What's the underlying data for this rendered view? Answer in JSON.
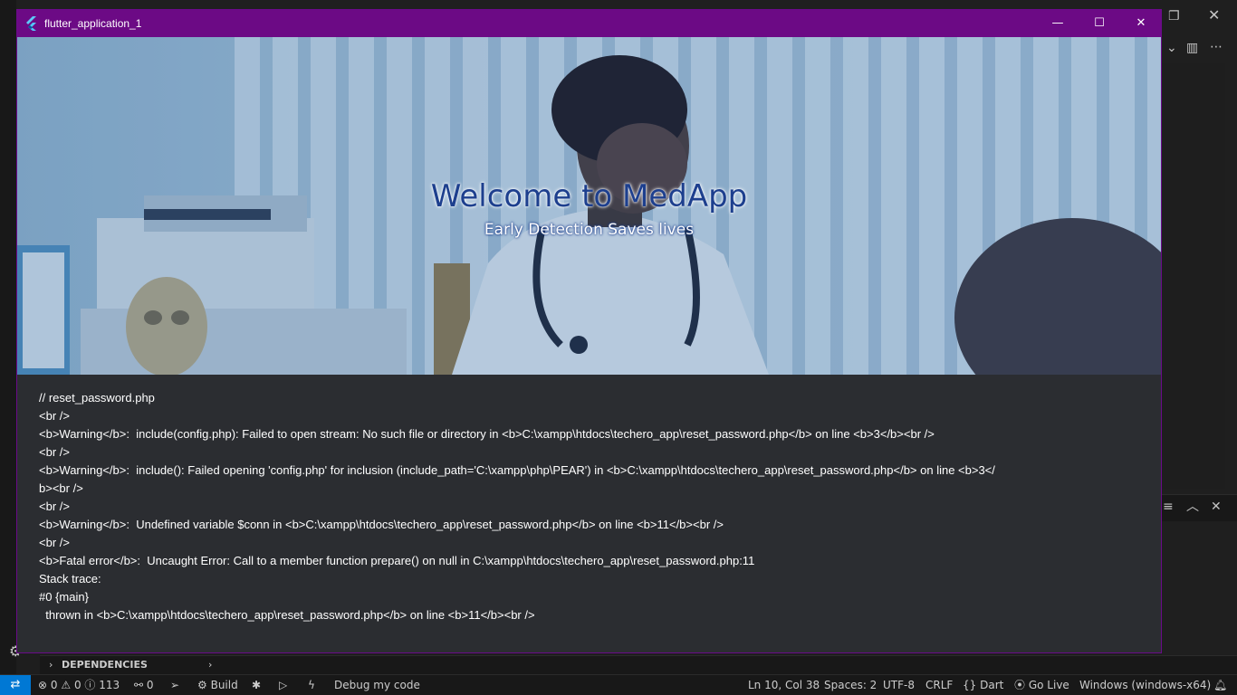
{
  "window": {
    "title": "flutter_application_1",
    "controls": {
      "minimize_icon": "minimize-icon",
      "maximize_icon": "maximize-icon",
      "close_icon": "close-icon"
    }
  },
  "hero": {
    "title": "Welcome to MedApp",
    "subtitle": "Early Detection Saves lives"
  },
  "error_log": [
    "// reset_password.php",
    "<br />",
    "<b>Warning</b>:  include(config.php): Failed to open stream: No such file or directory in <b>C:\\xampp\\htdocs\\techero_app\\reset_password.php</b> on line <b>3</b><br />",
    "<br />",
    "<b>Warning</b>:  include(): Failed opening 'config.php' for inclusion (include_path='C:\\xampp\\php\\PEAR') in <b>C:\\xampp\\htdocs\\techero_app\\reset_password.php</b> on line <b>3</",
    "b><br />",
    "<br />",
    "<b>Warning</b>:  Undefined variable $conn in <b>C:\\xampp\\htdocs\\techero_app\\reset_password.php</b> on line <b>11</b><br />",
    "<br />",
    "<b>Fatal error</b>:  Uncaught Error: Call to a member function prepare() on null in C:\\xampp\\htdocs\\techero_app\\reset_password.php:11",
    "Stack trace:",
    "#0 {main}",
    "  thrown in <b>C:\\xampp\\htdocs\\techero_app\\reset_password.php</b> on line <b>11</b><br />"
  ],
  "sidebar_section": {
    "label": "DEPENDENCIES"
  },
  "statusbar": {
    "errors": "0",
    "warnings": "0",
    "info": "113",
    "ports": "0",
    "build": "Build",
    "debug": "Debug my code",
    "cursor": "Ln 10, Col 38",
    "spaces": "Spaces: 2",
    "encoding": "UTF-8",
    "eol": "CRLF",
    "language": "Dart",
    "golive": "Go Live",
    "device": "Windows (windows-x64)"
  },
  "colors": {
    "titlebar": "#6c0a85",
    "hero_title": "#1d3f8e",
    "log_bg": "#2b2d31",
    "remote_indicator": "#0078d4"
  }
}
